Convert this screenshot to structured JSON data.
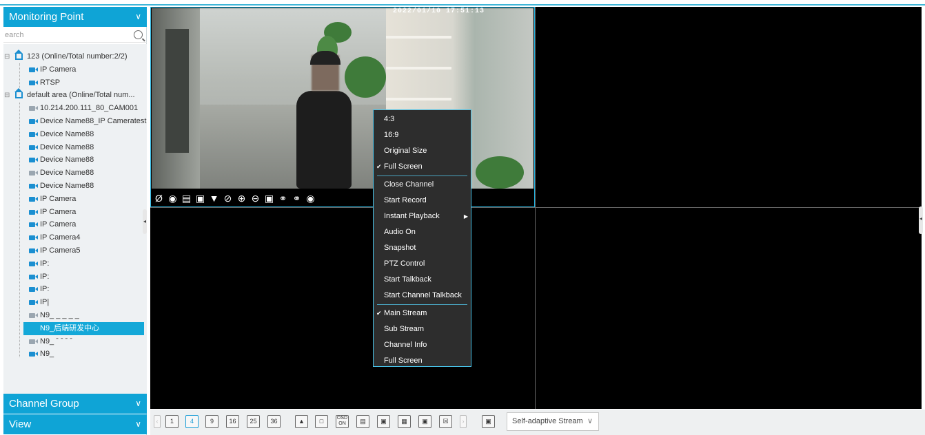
{
  "sidebar": {
    "monitoring_title": "Monitoring Point",
    "search_placeholder": "Search",
    "search_shown": "earch",
    "nodes": [
      {
        "label": "123 (Online/Total number:2/2)",
        "type": "area",
        "expand": "⊟"
      },
      {
        "label": "IP Camera",
        "type": "cam",
        "online": true
      },
      {
        "label": "RTSP",
        "type": "cam",
        "online": true
      },
      {
        "label": "default area (Online/Total num...",
        "type": "area",
        "expand": "⊟"
      },
      {
        "label": "10.214.200.111_80_CAM001",
        "type": "cam",
        "online": false
      },
      {
        "label": "Device Name88_IP Cameratest",
        "type": "cam",
        "online": true
      },
      {
        "label": "Device Name88",
        "type": "cam",
        "online": true
      },
      {
        "label": "Device Name88",
        "type": "cam",
        "online": true
      },
      {
        "label": "Device Name88",
        "type": "cam",
        "online": true
      },
      {
        "label": "Device Name88",
        "type": "cam",
        "online": false
      },
      {
        "label": "Device Name88",
        "type": "cam",
        "online": true
      },
      {
        "label": "IP Camera",
        "type": "cam",
        "online": true
      },
      {
        "label": "IP Camera",
        "type": "cam",
        "online": true
      },
      {
        "label": "IP Camera",
        "type": "cam",
        "online": true
      },
      {
        "label": "IP Camera4",
        "type": "cam",
        "online": true
      },
      {
        "label": "IP Camera5",
        "type": "cam",
        "online": true
      },
      {
        "label": "IP:",
        "type": "cam",
        "online": true
      },
      {
        "label": "IP:",
        "type": "cam",
        "online": true
      },
      {
        "label": "IP:",
        "type": "cam",
        "online": true
      },
      {
        "label": "IP|",
        "type": "cam",
        "online": true
      },
      {
        "label": "N9_ _ _ _ _",
        "type": "cam",
        "online": false
      },
      {
        "label": "N9_后端研发中心",
        "type": "cam",
        "online": true,
        "selected": true
      },
      {
        "label": "N9_ ˉ ˉ ˉ ˉ",
        "type": "cam",
        "online": false
      },
      {
        "label": "N9_",
        "type": "cam",
        "online": true
      }
    ],
    "channel_group_title": "Channel Group",
    "view_title": "View"
  },
  "video": {
    "timestamp": "2022/01/10  17:51:13",
    "toolbar_icons": [
      "eye-off-icon",
      "record-icon",
      "mute-icon",
      "snapshot-icon",
      "dome-icon",
      "no-zoom-icon",
      "zoom-in-icon",
      "zoom-out-icon",
      "fit-icon",
      "mic-icon",
      "mic-settings-icon",
      "location-icon"
    ]
  },
  "context_menu": {
    "items": [
      {
        "label": "4:3",
        "checked": false
      },
      {
        "label": "16:9",
        "checked": false
      },
      {
        "label": "Original Size",
        "checked": false
      },
      {
        "label": "Full Screen",
        "checked": true
      },
      {
        "separator": true
      },
      {
        "label": "Close Channel",
        "checked": false
      },
      {
        "label": "Start Record",
        "checked": false
      },
      {
        "label": "Instant Playback",
        "checked": false,
        "submenu": true
      },
      {
        "label": "Audio On",
        "checked": false
      },
      {
        "label": "Snapshot",
        "checked": false
      },
      {
        "label": "PTZ Control",
        "checked": false
      },
      {
        "label": "Start Talkback",
        "checked": false
      },
      {
        "label": "Start Channel Talkback",
        "checked": false
      },
      {
        "separator": true
      },
      {
        "label": "Main Stream",
        "checked": true
      },
      {
        "label": "Sub Stream",
        "checked": false
      },
      {
        "label": "Channel Info",
        "checked": false
      },
      {
        "label": "Full Screen",
        "checked": false
      }
    ]
  },
  "bottombar": {
    "layout_buttons": [
      "1",
      "4",
      "9",
      "16",
      "25",
      "36"
    ],
    "selected_layout": "4",
    "stream_select": "Self-adaptive Stream"
  },
  "colors": {
    "accent": "#0fa4d6",
    "menu_bg": "#2d2d2d",
    "menu_border": "#49c2e8"
  }
}
